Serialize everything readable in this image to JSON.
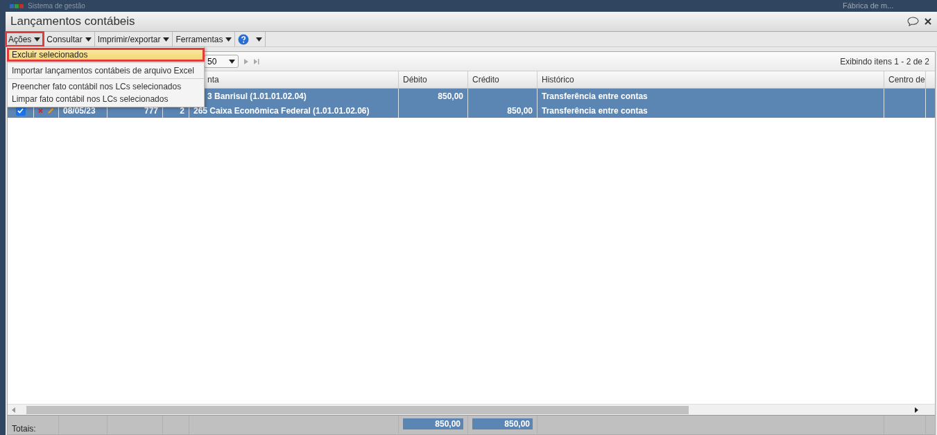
{
  "app_bar": {
    "title": "Sistema de gestão",
    "company": "Fábrica de m..."
  },
  "window": {
    "title": "Lançamentos contábeis"
  },
  "toolbar": [
    {
      "label": "Ações",
      "selected": true
    },
    {
      "label": "Consultar",
      "selected": false
    },
    {
      "label": "Imprimir/exportar",
      "selected": false
    },
    {
      "label": "Ferramentas",
      "selected": false
    }
  ],
  "menu": [
    {
      "label": "Excluir selecionados",
      "highlighted": true,
      "separator_after": true
    },
    {
      "label": "Importar lançamentos contábeis de arquivo Excel",
      "highlighted": false,
      "separator_after": true
    },
    {
      "label": "Preencher fato contábil nos LCs selecionados",
      "highlighted": false,
      "separator_after": false
    },
    {
      "label": "Limpar fato contábil nos LCs selecionados",
      "highlighted": false,
      "separator_after": false
    }
  ],
  "pager": {
    "page_size": "50",
    "summary": "Exibindo itens 1 - 2 de 2"
  },
  "table": {
    "columns": [
      "nta",
      "Débito",
      "Crédito",
      "Histórico",
      "Centro de"
    ],
    "rows": [
      {
        "selected": true,
        "conta": "3 Banrisul (1.01.01.02.04)",
        "debito": "850,00",
        "historico": "Transferência entre contas"
      },
      {
        "selected": true,
        "checked": true,
        "date": "08/05/23",
        "doc": "777",
        "seq": "2",
        "conta": "265 Caixa Econômica Federal (1.01.01.02.06)",
        "credito": "850,00",
        "historico": "Transferência entre contas"
      }
    ],
    "totals": {
      "label": "Totais:",
      "debito": "850,00",
      "credito": "850,00"
    }
  }
}
